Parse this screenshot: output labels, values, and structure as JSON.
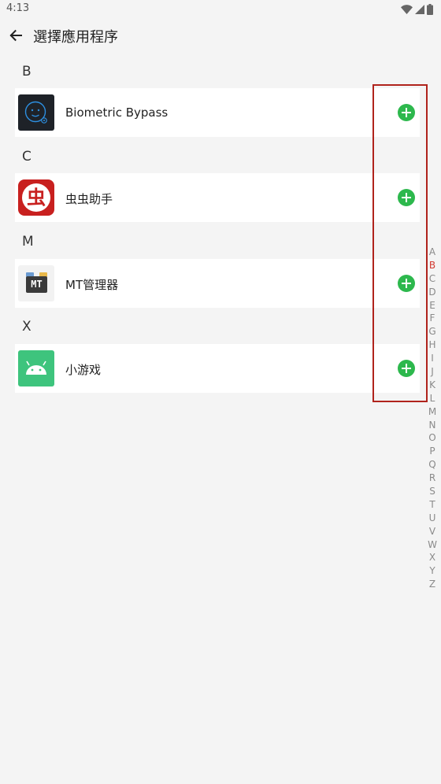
{
  "status_bar": {
    "time": "4:13"
  },
  "toolbar": {
    "title": "選擇應用程序"
  },
  "accent_colors": {
    "add": "#2db84d",
    "index_active": "#d23b32",
    "highlight_border": "#b0231c"
  },
  "sections": [
    {
      "letter": "B",
      "apps": [
        {
          "name": "Biometric Bypass",
          "icon": "face-scan-icon"
        }
      ]
    },
    {
      "letter": "C",
      "apps": [
        {
          "name": "虫虫助手",
          "icon": "chongchong-icon",
          "icon_text": "虫"
        }
      ]
    },
    {
      "letter": "M",
      "apps": [
        {
          "name": "MT管理器",
          "icon": "mt-manager-icon",
          "icon_text": "MT"
        }
      ]
    },
    {
      "letter": "X",
      "apps": [
        {
          "name": "小游戏",
          "icon": "android-icon"
        }
      ]
    }
  ],
  "index_bar": {
    "letters": [
      "A",
      "B",
      "C",
      "D",
      "E",
      "F",
      "G",
      "H",
      "I",
      "J",
      "K",
      "L",
      "M",
      "N",
      "O",
      "P",
      "Q",
      "R",
      "S",
      "T",
      "U",
      "V",
      "W",
      "X",
      "Y",
      "Z"
    ],
    "active": "B"
  }
}
